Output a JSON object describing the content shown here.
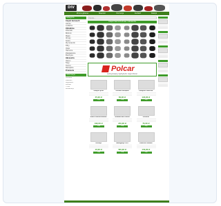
{
  "site": {
    "logo_text": "DIV",
    "nav": [
      "Strona główna",
      "Nowości",
      "Promocje",
      "Kontakt",
      "Koszyk"
    ]
  },
  "left": {
    "categories_head": "Kategorie",
    "categories": [
      {
        "label": "Części karoserii",
        "bold": true
      },
      {
        "label": "Lampy",
        "bold": false
      },
      {
        "label": "Lusterka",
        "bold": false
      },
      {
        "label": "Chłodnice",
        "bold": true
      },
      {
        "label": "Zderzaki",
        "bold": false
      },
      {
        "label": "Błotniki",
        "bold": false
      },
      {
        "label": "Maski",
        "bold": false
      },
      {
        "label": "Atrapy",
        "bold": false
      },
      {
        "label": "Szyby",
        "bold": false
      },
      {
        "label": "Wycieraczki",
        "bold": false
      },
      {
        "label": "Filtry",
        "bold": false
      },
      {
        "label": "Oleje",
        "bold": false
      },
      {
        "label": "Hamulce",
        "bold": false
      },
      {
        "label": "Zawieszenie",
        "bold": false
      },
      {
        "label": "Elektryka",
        "bold": false
      },
      {
        "label": "Akcesoria",
        "bold": true
      },
      {
        "label": "Opony",
        "bold": false
      },
      {
        "label": "Felgi",
        "bold": false
      },
      {
        "label": "Tuning",
        "bold": false
      },
      {
        "label": "Narzędzia",
        "bold": false
      },
      {
        "label": "Promocje",
        "bold": true
      }
    ],
    "info_head": "Informacje",
    "info": [
      "Dostawa",
      "Płatności",
      "Regulamin",
      "Kontakt",
      "O nas",
      "Reklamacje"
    ]
  },
  "center": {
    "search_placeholder": "Szukaj...",
    "banner_title": "Części Samochodowe i Akcesoria",
    "polcar": {
      "name": "Polcar",
      "tagline": "Autoryzowany dystrybutor części Polcar"
    },
    "products": [
      {
        "title": "Lampa tylna",
        "price": "45,00 zł",
        "button": "Kup"
      },
      {
        "title": "Zestaw narzędzi",
        "price": "89,00 zł",
        "button": "Kup"
      },
      {
        "title": "Komplet lusterek",
        "price": "120,00 zł",
        "button": "Kup"
      },
      {
        "title": "Radio samochodowe",
        "price": "199,00 zł",
        "button": "Kup"
      },
      {
        "title": "Wzmacniacz audio",
        "price": "249,00 zł",
        "button": "Kup"
      },
      {
        "title": "Głośniki",
        "price": "79,00 zł",
        "button": "Kup"
      },
      {
        "title": "Uchwyt",
        "price": "19,00 zł",
        "button": "Kup"
      },
      {
        "title": "Nawigacja GPS",
        "price": "399,00 zł",
        "button": "Kup"
      },
      {
        "title": "Kamera cofania",
        "price": "149,00 zł",
        "button": "Kup"
      }
    ]
  },
  "colors": {
    "brand_green": "#3f9c2a",
    "nav_green": "#3f7f1c",
    "polcar_red": "#d8231d"
  }
}
